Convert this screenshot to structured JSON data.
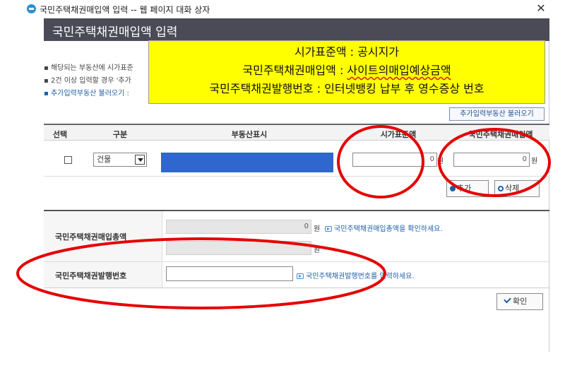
{
  "window": {
    "title": "국민주택채권매입액 입력 -- 웹 페이지 대화 상자",
    "close": "✕"
  },
  "header": {
    "title": "국민주택채권매입액 입력"
  },
  "notes": [
    "▪ 해당되는 부동산에 시가표준",
    "▪ 2건 이상 입력할 경우 '추가",
    "▪ 추가입력부동산 불러오기 :"
  ],
  "tooltip": {
    "line1": "시가표준액 : 공시지가",
    "line2_prefix": "국민주택채권매입액 : ",
    "line2_emph": "사이트의매입예상금액",
    "line3": "국민주택채권발행번호 : 인터넷뱅킹 납부 후 영수증상 번호"
  },
  "toolbar": {
    "load_label": "추가입력부동산 불러오기"
  },
  "table": {
    "columns": [
      "선택",
      "구분",
      "부동산표시",
      "시가표준액",
      "국민주택채권매입액"
    ],
    "row": {
      "type_value": "건물",
      "price_value": "0",
      "price_unit": "원",
      "buy_value": "0",
      "buy_unit": "원"
    }
  },
  "actions": {
    "add_label": "추가",
    "delete_label": "삭제"
  },
  "summary": {
    "total_label": "국민주택채권매입총액",
    "total_value": "0",
    "total_unit": "원",
    "total_hint": "국민주택채권매입총액을 확인하세요.",
    "second_unit": "원",
    "bond_label": "국민주택채권발행번호",
    "bond_hint": "국민주택채권발행번호를 입력하세요."
  },
  "confirm": {
    "label": "확인"
  },
  "colors": {
    "header_bg": "#4b4b57",
    "tooltip_bg": "#ffff00",
    "annotation": "#e60000",
    "link": "#1c5ea8"
  }
}
